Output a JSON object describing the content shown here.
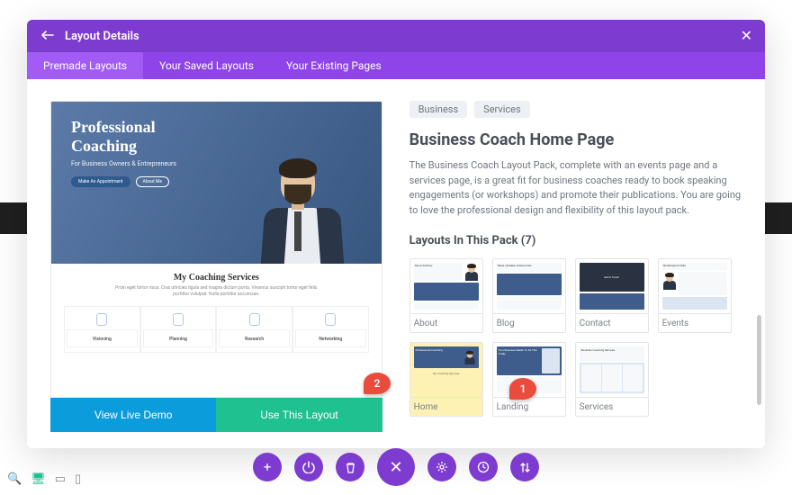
{
  "modal": {
    "title": "Layout Details",
    "tabs": [
      "Premade Layouts",
      "Your Saved Layouts",
      "Your Existing Pages"
    ],
    "active_tab": 0
  },
  "preview": {
    "hero_title_1": "Professional",
    "hero_title_2": "Coaching",
    "hero_subtitle": "For Business Owners & Entrepreneurs",
    "hero_btn1": "Make An Appointment",
    "hero_btn2": "About Me",
    "services_title": "My Coaching Services",
    "services_desc": "Proin eget tortor risus. Cras ultricies ligula sed magna dictum porta. Vivamus suscipit tortor eget felis porttitor volutpat. Nulla porttitor accumsan.",
    "service_icons": [
      "Visioning",
      "Planning",
      "Research",
      "Networking"
    ]
  },
  "preview_actions": {
    "demo": "View Live Demo",
    "use": "Use This Layout"
  },
  "details": {
    "tags": [
      "Business",
      "Services"
    ],
    "heading": "Business Coach Home Page",
    "description": "The Business Coach Layout Pack, complete with an events page and a services page, is a great fit for business coaches ready to book speaking engagements (or workshops) and promote their publications. You are going to love the professional design and flexibility of this layout pack.",
    "pack_heading": "Layouts In This Pack (7)",
    "pack_count": 7,
    "layouts": [
      "About",
      "Blog",
      "Contact",
      "Events",
      "Home",
      "Landing",
      "Services"
    ],
    "selected": "Home"
  },
  "markers": {
    "m1": "1",
    "m2": "2"
  },
  "thumb_text": {
    "about": "About Anthony",
    "blog": "News, Updates, & Resources",
    "contact": "Get In Touch",
    "events": "Workshops & Talks",
    "home_title": "Professional Coaching",
    "home_services": "My Coaching Services",
    "landing": "Your Business Needs To Do This Today",
    "services": "Business Coaching Services"
  }
}
